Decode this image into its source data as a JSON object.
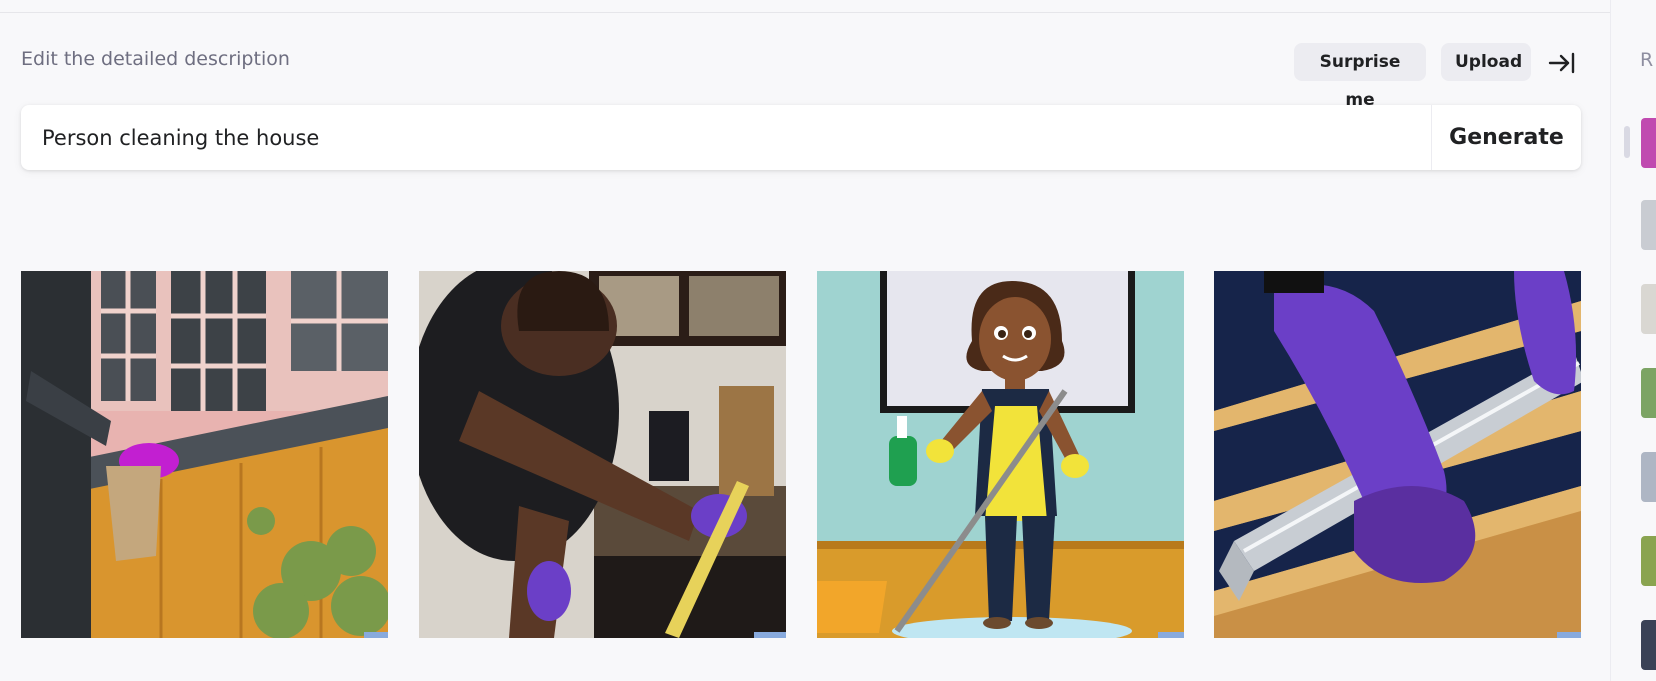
{
  "header": {
    "label": "Edit the detailed description",
    "surprise_label": "Surprise me",
    "upload_label": "Upload",
    "collapse_icon": "collapse-right-icon"
  },
  "prompt": {
    "value": "Person cleaning the house",
    "generate_label": "Generate"
  },
  "results": [
    {
      "subject": "gloved-hand-cleaning-window-ledge"
    },
    {
      "subject": "man-cleaning-kitchen-counter"
    },
    {
      "subject": "cartoon-woman-with-spray-and-mop"
    },
    {
      "subject": "gloved-hands-cleaning-stair-rail"
    }
  ],
  "sidebar": {
    "label": "R",
    "thumbnails": 8
  },
  "colors": {
    "accent_glove_magenta": "#c21fd1",
    "accent_glove_purple": "#6b3fc7",
    "background": "#f8f8fa"
  }
}
